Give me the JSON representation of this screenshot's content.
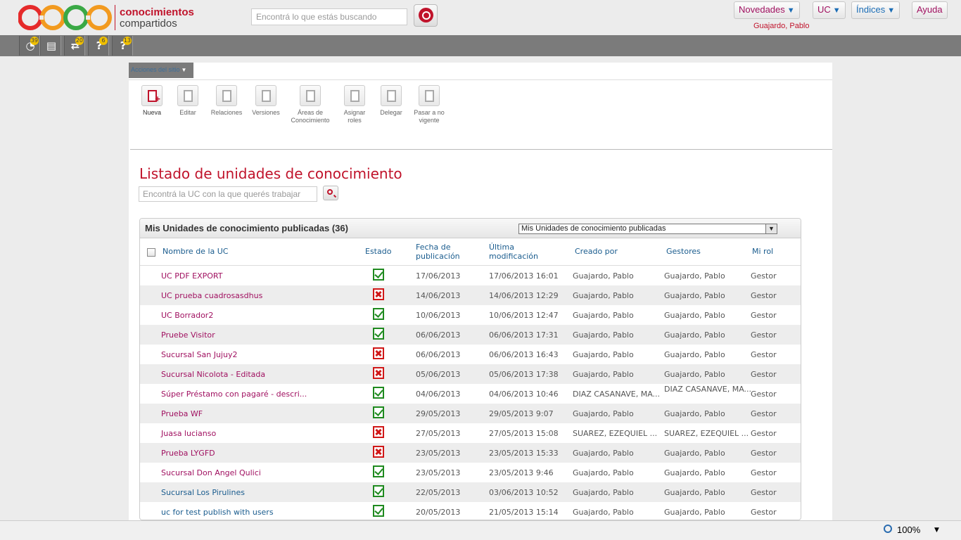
{
  "header": {
    "logo_line1": "conocimientos",
    "logo_line2": "compartidos",
    "search_placeholder": "Encontrá lo que estás buscando",
    "nav": [
      {
        "label": "Novedades",
        "arrow": "▼"
      },
      {
        "label": "UC",
        "arrow": "▼"
      },
      {
        "label": "Índices",
        "arrow": "▼"
      },
      {
        "label": "Ayuda",
        "arrow": ""
      }
    ],
    "user": "Guajardo, Pablo"
  },
  "darkbar": {
    "icons": [
      {
        "name": "dashboard-icon",
        "glyph": "◔",
        "badge": "39"
      },
      {
        "name": "document-icon",
        "glyph": "▤",
        "badge": ""
      },
      {
        "name": "refresh-icon",
        "glyph": "⇄",
        "badge": "20"
      },
      {
        "name": "cursor-help-icon",
        "glyph": "?",
        "badge": "6"
      },
      {
        "name": "question-icon",
        "glyph": "?",
        "badge": "13"
      }
    ]
  },
  "site": {
    "acciones_label": "Acciones del sitio",
    "actions": [
      {
        "line1": "Nueva",
        "line2": ""
      },
      {
        "line1": "Editar",
        "line2": ""
      },
      {
        "line1": "Relaciones",
        "line2": ""
      },
      {
        "line1": "Versiones",
        "line2": ""
      },
      {
        "line1": "Áreas de",
        "line2": "Conocimiento"
      },
      {
        "line1": "Asignar",
        "line2": "roles"
      },
      {
        "line1": "Delegar",
        "line2": ""
      },
      {
        "line1": "Pasar a no",
        "line2": "vigente"
      }
    ],
    "title": "Listado de unidades de conocimiento",
    "uc_search_placeholder": "Encontrá la UC con la que querés trabajar"
  },
  "list": {
    "title": "Mis Unidades de conocimiento publicadas (36)",
    "select_value": "Mis Unidades de conocimiento publicadas",
    "columns": {
      "name": "Nombre de la UC",
      "estado": "Estado",
      "fecha1": "Fecha de",
      "fecha2": "publicación",
      "ultima1": "Última",
      "ultima2": "modificación",
      "creado": "Creado por",
      "gestores": "Gestores",
      "rol": "Mi rol"
    },
    "rows": [
      {
        "name": "UC PDF EXPORT",
        "estado": "ok",
        "pub": "17/06/2013",
        "mod": "17/06/2013 16:01",
        "creado": "Guajardo, Pablo",
        "gestores": "Guajardo, Pablo",
        "rol": "Gestor",
        "blue": false
      },
      {
        "name": "UC prueba cuadrosasdhus",
        "estado": "bad",
        "pub": "14/06/2013",
        "mod": "14/06/2013 12:29",
        "creado": "Guajardo, Pablo",
        "gestores": "Guajardo, Pablo",
        "rol": "Gestor",
        "blue": false
      },
      {
        "name": "UC Borrador2",
        "estado": "ok",
        "pub": "10/06/2013",
        "mod": "10/06/2013 12:47",
        "creado": "Guajardo, Pablo",
        "gestores": "Guajardo, Pablo",
        "rol": "Gestor",
        "blue": false
      },
      {
        "name": "Pruebe Visitor",
        "estado": "ok",
        "pub": "06/06/2013",
        "mod": "06/06/2013 17:31",
        "creado": "Guajardo, Pablo",
        "gestores": "Guajardo, Pablo",
        "rol": "Gestor",
        "blue": false
      },
      {
        "name": "Sucursal San Jujuy2",
        "estado": "bad",
        "pub": "06/06/2013",
        "mod": "06/06/2013 16:43",
        "creado": "Guajardo, Pablo",
        "gestores": "Guajardo, Pablo",
        "rol": "Gestor",
        "blue": false
      },
      {
        "name": "Sucursal Nicolota - Editada",
        "estado": "bad",
        "pub": "05/06/2013",
        "mod": "05/06/2013 17:38",
        "creado": "Guajardo, Pablo",
        "gestores": "Guajardo, Pablo",
        "rol": "Gestor",
        "blue": false
      },
      {
        "name": "Súper Préstamo con pagaré - descri...",
        "estado": "ok",
        "pub": "04/06/2013",
        "mod": "04/06/2013 10:46",
        "creado": "DIAZ CASANAVE, MA...",
        "gestores": "DIAZ CASANAVE, MA...",
        "rol": "Gestor",
        "blue": false,
        "wrap": true
      },
      {
        "name": "Prueba WF",
        "estado": "ok",
        "pub": "29/05/2013",
        "mod": "29/05/2013 9:07",
        "creado": "Guajardo, Pablo",
        "gestores": "Guajardo, Pablo",
        "rol": "Gestor",
        "blue": false
      },
      {
        "name": "Juasa lucianso",
        "estado": "bad",
        "pub": "27/05/2013",
        "mod": "27/05/2013 15:08",
        "creado": "SUAREZ, EZEQUIEL ...",
        "gestores": "SUAREZ, EZEQUIEL ...",
        "rol": "Gestor",
        "blue": false
      },
      {
        "name": "Prueba LYGFD",
        "estado": "bad",
        "pub": "23/05/2013",
        "mod": "23/05/2013 15:33",
        "creado": "Guajardo, Pablo",
        "gestores": "Guajardo, Pablo",
        "rol": "Gestor",
        "blue": false
      },
      {
        "name": "Sucursal Don Angel Qulici",
        "estado": "ok",
        "pub": "23/05/2013",
        "mod": "23/05/2013 9:46",
        "creado": "Guajardo, Pablo",
        "gestores": "Guajardo, Pablo",
        "rol": "Gestor",
        "blue": false
      },
      {
        "name": "Sucursal Los Pirulines",
        "estado": "ok",
        "pub": "22/05/2013",
        "mod": "03/06/2013 10:52",
        "creado": "Guajardo, Pablo",
        "gestores": "Guajardo, Pablo",
        "rol": "Gestor",
        "blue": true
      },
      {
        "name": "uc for test publish with users",
        "estado": "ok",
        "pub": "20/05/2013",
        "mod": "21/05/2013 15:14",
        "creado": "Guajardo, Pablo",
        "gestores": "Guajardo, Pablo",
        "rol": "Gestor",
        "blue": true
      }
    ]
  },
  "status": {
    "zoom": "100%"
  }
}
